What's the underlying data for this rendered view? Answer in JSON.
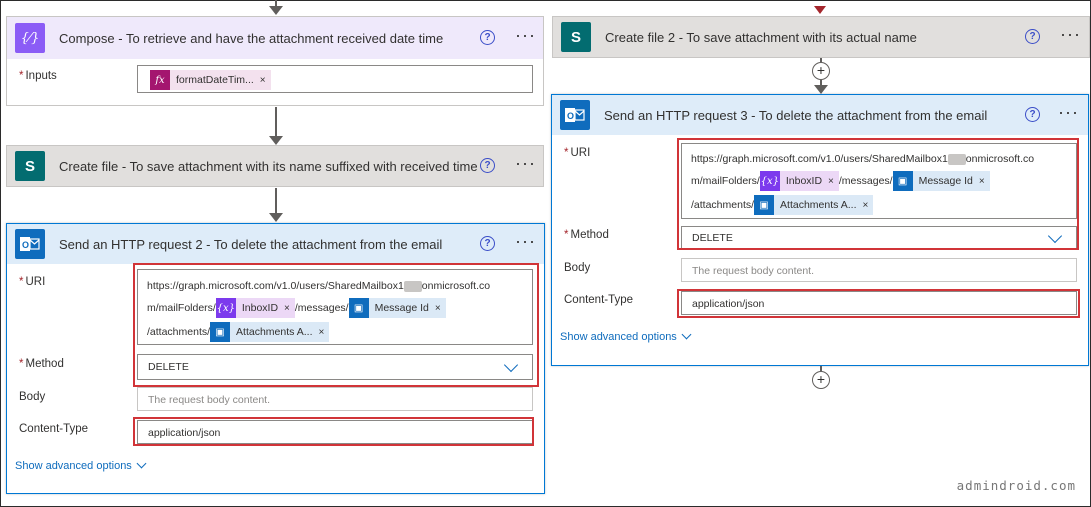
{
  "compose": {
    "title": "Compose - To retrieve and have the attachment received date time",
    "icon": "curly-braces-icon",
    "inputs_label": "Inputs",
    "token_label": "formatDateTim...",
    "token_icon_glyph": "fx",
    "token_remove": "×"
  },
  "create_file": {
    "title": "Create file - To save attachment with its name suffixed with received time",
    "icon_glyph": "S"
  },
  "http2": {
    "title": "Send an HTTP request 2 - To delete the attachment from the email",
    "uri_label": "URI",
    "uri_line1": "https://graph.microsoft.com/v1.0/users/SharedMailbox1",
    "uri_line1_tail": "onmicrosoft.co",
    "uri_line2_prefix": "m/mailFolders/",
    "inbox_token": "InboxID",
    "messages_text": "/messages/",
    "message_token": "Message Id",
    "attachments_text": "/attachments/",
    "attachments_token": "Attachments A...",
    "token_remove": "×",
    "var_glyph": "{x}",
    "method_label": "Method",
    "method_value": "DELETE",
    "body_label": "Body",
    "body_placeholder": "The request body content.",
    "content_type_label": "Content-Type",
    "content_type_value": "application/json",
    "advanced": "Show advanced options"
  },
  "create_file2": {
    "title": "Create file 2 - To save attachment with its actual name",
    "icon_glyph": "S"
  },
  "http3": {
    "title": "Send an HTTP request 3 - To delete the attachment from the email",
    "uri_label": "URI",
    "uri_line1": "https://graph.microsoft.com/v1.0/users/SharedMailbox1",
    "uri_line1_tail": "onmicrosoft.co",
    "uri_line2_prefix": "m/mailFolders/",
    "inbox_token": "InboxID",
    "messages_text": "/messages/",
    "message_token": "Message Id",
    "attachments_text": "/attachments/",
    "attachments_token": "Attachments A...",
    "token_remove": "×",
    "var_glyph": "{x}",
    "method_label": "Method",
    "method_value": "DELETE",
    "body_label": "Body",
    "body_placeholder": "The request body content.",
    "content_type_label": "Content-Type",
    "content_type_value": "application/json",
    "advanced": "Show advanced options"
  },
  "common": {
    "required_mark": "*",
    "help_glyph": "?",
    "more_glyph": "···",
    "plus_glyph": "+"
  },
  "watermark": "admindroid.com",
  "colors": {
    "required": "#a4262c",
    "highlight_box": "#d13438",
    "link": "#0f6cbd",
    "compose_header": "#efe9fb",
    "http_header": "#deecf9",
    "sharepoint": "#036c70"
  }
}
